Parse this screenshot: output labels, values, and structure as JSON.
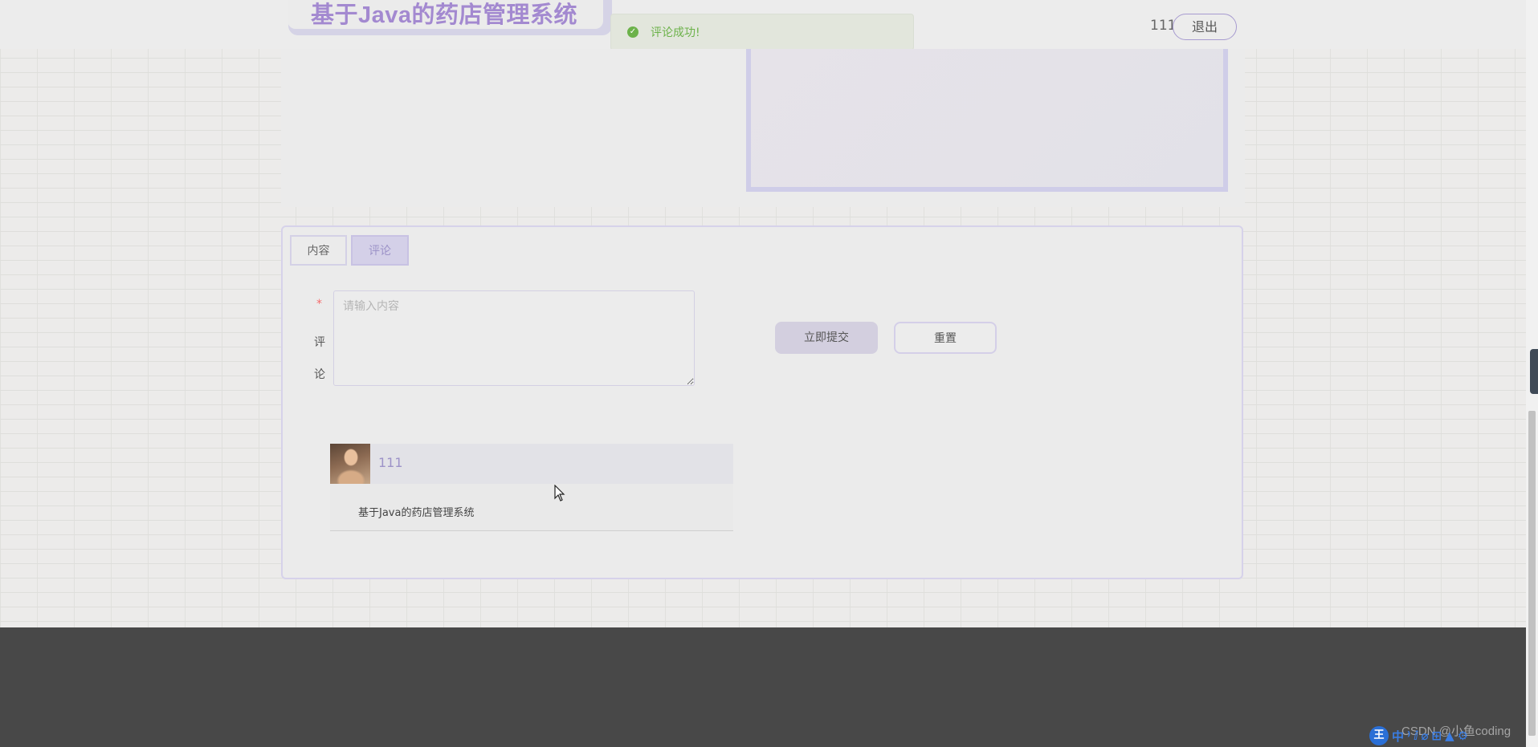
{
  "header": {
    "title": "基于Java的药店管理系统",
    "username": "111",
    "logout_label": "退出"
  },
  "toast": {
    "message": "评论成功!",
    "type": "success",
    "color": "#6cb24a"
  },
  "tabs": [
    {
      "label": "内容",
      "active": false
    },
    {
      "label": "评论",
      "active": true
    }
  ],
  "comment_form": {
    "required_mark": "*",
    "label_chars": [
      "评",
      "论"
    ],
    "placeholder": "请输入内容",
    "value": "",
    "submit_label": "立即提交",
    "reset_label": "重置"
  },
  "comments": [
    {
      "user": "111",
      "text": "基于Java的药店管理系统"
    }
  ],
  "taskbar": {
    "watermark": "CSDN @小鱼coding",
    "ime_logo": "王",
    "ime_keys": [
      "中",
      "⁾",
      "ⅈ",
      "⌀",
      "⊞",
      "▲",
      "⚙"
    ]
  },
  "colors": {
    "accent": "#a389d0",
    "tab_active_text": "#9d93c8",
    "footer": "#484848"
  }
}
